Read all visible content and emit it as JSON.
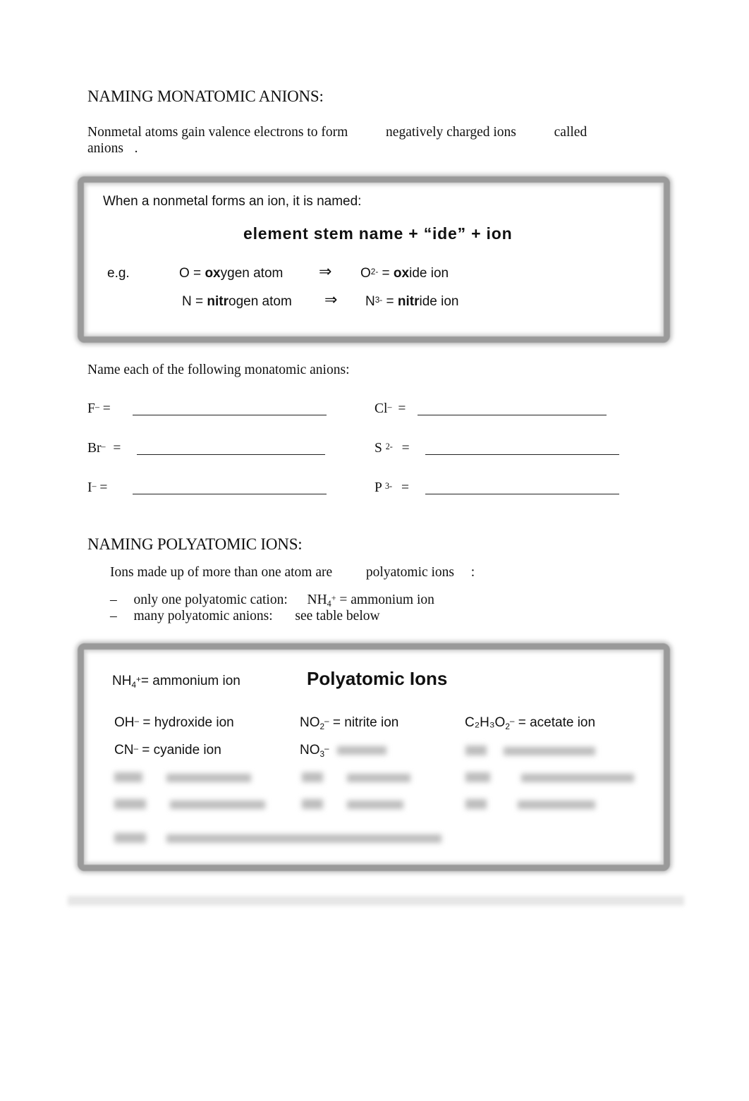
{
  "section1": {
    "heading": "NAMING MONATOMIC ANIONS:",
    "intro_part1": "Nonmetal atoms gain valence electrons to form",
    "intro_blank1": "negatively charged ions",
    "intro_part2": "called",
    "intro_blank2": "anions",
    "intro_end": "."
  },
  "rule_box": {
    "intro": "When a nonmetal forms an ion, it is named:",
    "formula": "element stem name + “ide” + ion",
    "eg_label": "e.g.",
    "examples": [
      {
        "atom_symbol": "O",
        "atom_eq": " = ",
        "atom_stem": "ox",
        "atom_rest": "ygen atom",
        "arrow": "⇒",
        "ion_symbol": "O",
        "ion_charge": "2-",
        "ion_eq": " = ",
        "ion_stem": "ox",
        "ion_rest": "ide ion"
      },
      {
        "atom_symbol": "N",
        "atom_eq": " = ",
        "atom_stem": "nitr",
        "atom_rest": "ogen atom",
        "arrow": "⇒",
        "ion_symbol": "N",
        "ion_charge": "3-",
        "ion_eq": " = ",
        "ion_stem": "nitr",
        "ion_rest": "ide ion"
      }
    ]
  },
  "exercise": {
    "prompt": "Name each of the following monatomic anions:",
    "equals": "=",
    "items": [
      {
        "symbol": "F",
        "charge": "–",
        "answer": ""
      },
      {
        "symbol": "Cl",
        "charge": "–",
        "answer": ""
      },
      {
        "symbol": "Br",
        "charge": "–",
        "answer": ""
      },
      {
        "symbol": "S",
        "charge": "2-",
        "answer": ""
      },
      {
        "symbol": "I",
        "charge": "–",
        "answer": ""
      },
      {
        "symbol": "P",
        "charge": "3-",
        "answer": ""
      }
    ]
  },
  "section2": {
    "heading": "NAMING POLYATOMIC IONS:",
    "intro_part1": "Ions made up of more than one atom are",
    "intro_blank": "polyatomic ions",
    "intro_end": ":",
    "bullet_dash": "–",
    "bullets": [
      {
        "label": "only one polyatomic cation:",
        "formula": "NH",
        "sub": "4",
        "sup": "+",
        "text": " = ammonium ion"
      },
      {
        "label": "many polyatomic anions:",
        "text": "see table below"
      }
    ]
  },
  "poly_box": {
    "title": "Polyatomic Ions",
    "ammonium": {
      "formula": "NH",
      "sub": "4",
      "sup": "+",
      "text": "= ammonium ion"
    },
    "ions": [
      {
        "f": "OH",
        "sub": "",
        "charge": "–",
        "name": "= hydroxide ion"
      },
      {
        "f": "NO",
        "sub": "2",
        "charge": "–",
        "name": "= nitrite ion"
      },
      {
        "f": "C₂H₃O",
        "sub": "2",
        "charge": "–",
        "name": "= acetate ion"
      },
      {
        "f": "CN",
        "sub": "",
        "charge": "–",
        "name": "= cyanide ion"
      },
      {
        "f": "NO",
        "sub": "3",
        "charge": "–",
        "name": ""
      }
    ],
    "obscured_note": "remaining entries are blurred / unreadable"
  }
}
